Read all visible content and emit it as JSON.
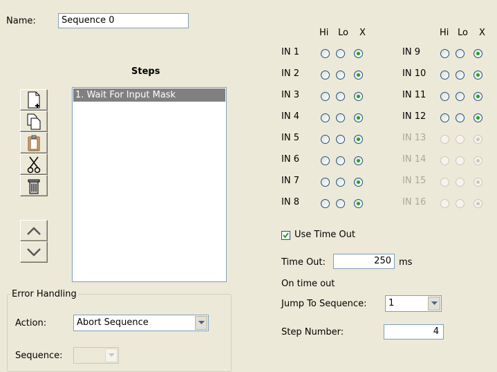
{
  "name": {
    "label": "Name:",
    "value": "Sequence 0"
  },
  "steps": {
    "title": "Steps",
    "items": [
      "1. Wait For Input Mask"
    ],
    "toolbar": [
      "new-step",
      "copy",
      "paste",
      "cut",
      "delete",
      "move-up",
      "move-down"
    ]
  },
  "error_handling": {
    "legend": "Error Handling",
    "action_label": "Action:",
    "action_value": "Abort Sequence",
    "sequence_label": "Sequence:",
    "sequence_value": ""
  },
  "inputs": {
    "headers": {
      "hi": "Hi",
      "lo": "Lo",
      "x": "X"
    },
    "left": [
      {
        "label": "IN 1",
        "state": "X",
        "enabled": true
      },
      {
        "label": "IN 2",
        "state": "X",
        "enabled": true
      },
      {
        "label": "IN 3",
        "state": "X",
        "enabled": true
      },
      {
        "label": "IN 4",
        "state": "X",
        "enabled": true
      },
      {
        "label": "IN 5",
        "state": "X",
        "enabled": true
      },
      {
        "label": "IN 6",
        "state": "X",
        "enabled": true
      },
      {
        "label": "IN 7",
        "state": "X",
        "enabled": true
      },
      {
        "label": "IN 8",
        "state": "X",
        "enabled": true
      }
    ],
    "right": [
      {
        "label": "IN 9",
        "state": "X",
        "enabled": true
      },
      {
        "label": "IN 10",
        "state": "X",
        "enabled": true
      },
      {
        "label": "IN 11",
        "state": "X",
        "enabled": true
      },
      {
        "label": "IN 12",
        "state": "X",
        "enabled": true
      },
      {
        "label": "IN 13",
        "state": "X",
        "enabled": false
      },
      {
        "label": "IN 14",
        "state": "X",
        "enabled": false
      },
      {
        "label": "IN 15",
        "state": "X",
        "enabled": false
      },
      {
        "label": "IN 16",
        "state": "X",
        "enabled": false
      }
    ]
  },
  "timeout": {
    "use_label": "Use Time Out",
    "use_checked": true,
    "label": "Time Out:",
    "value": "250",
    "unit": "ms",
    "on_timeout_label": "On time out",
    "jump_label": "Jump To Sequence:",
    "jump_value": "1",
    "step_label": "Step Number:",
    "step_value": "4"
  },
  "colors": {
    "selected_row": "#808080",
    "radio_on": "#21a121",
    "disabled_text": "#aca899"
  }
}
